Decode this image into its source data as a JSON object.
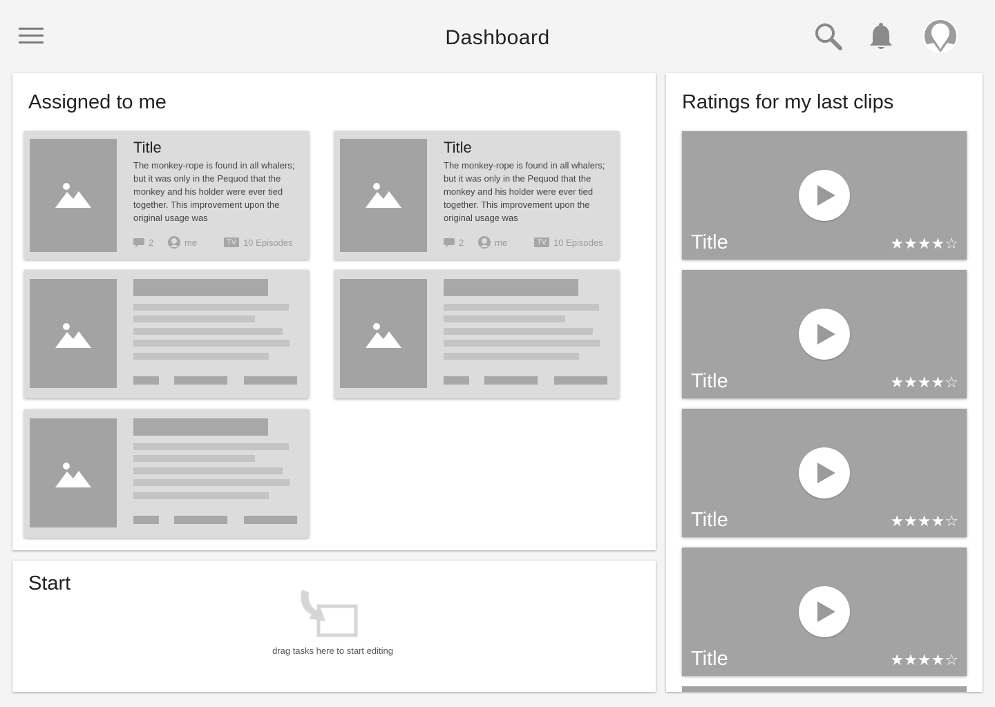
{
  "header": {
    "title": "Dashboard"
  },
  "assigned": {
    "title": "Assigned to me",
    "cards": [
      {
        "title": "Title",
        "description": "The monkey-rope is found in all whalers; but it was only in the Pequod that the monkey and his holder were ever tied together. This improvement upon the original usage was",
        "comments": "2",
        "assignee": "me",
        "badge": "TV",
        "episodes": "10 Episodes"
      },
      {
        "title": "Title",
        "description": "The monkey-rope is found in all whalers; but it was only in the Pequod that the monkey and his holder were ever tied together. This improvement upon the original usage was",
        "comments": "2",
        "assignee": "me",
        "badge": "TV",
        "episodes": "10 Episodes"
      }
    ]
  },
  "start": {
    "title": "Start",
    "hint": "drag tasks here to start editing"
  },
  "ratings": {
    "title": "Ratings for my last clips",
    "clips": [
      {
        "title": "Title",
        "rating": 4,
        "max_rating": 5,
        "stars": "★★★★☆"
      },
      {
        "title": "Title",
        "rating": 4,
        "max_rating": 5,
        "stars": "★★★★☆"
      },
      {
        "title": "Title",
        "rating": 4,
        "max_rating": 5,
        "stars": "★★★★☆"
      },
      {
        "title": "Title",
        "rating": 4,
        "max_rating": 5,
        "stars": "★★★★☆"
      }
    ]
  },
  "icons": {
    "menu": "hamburger-menu-icon",
    "search": "search-icon",
    "notifications": "bell-icon",
    "profile": "avatar-icon",
    "image_placeholder": "image-icon",
    "comment": "comment-icon",
    "user": "user-icon",
    "play": "play-icon",
    "drop": "drop-target-icon"
  },
  "colors": {
    "background": "#f4f4f4",
    "panel": "#ffffff",
    "card": "#dcdcdc",
    "placeholder": "#a3a3a3"
  }
}
